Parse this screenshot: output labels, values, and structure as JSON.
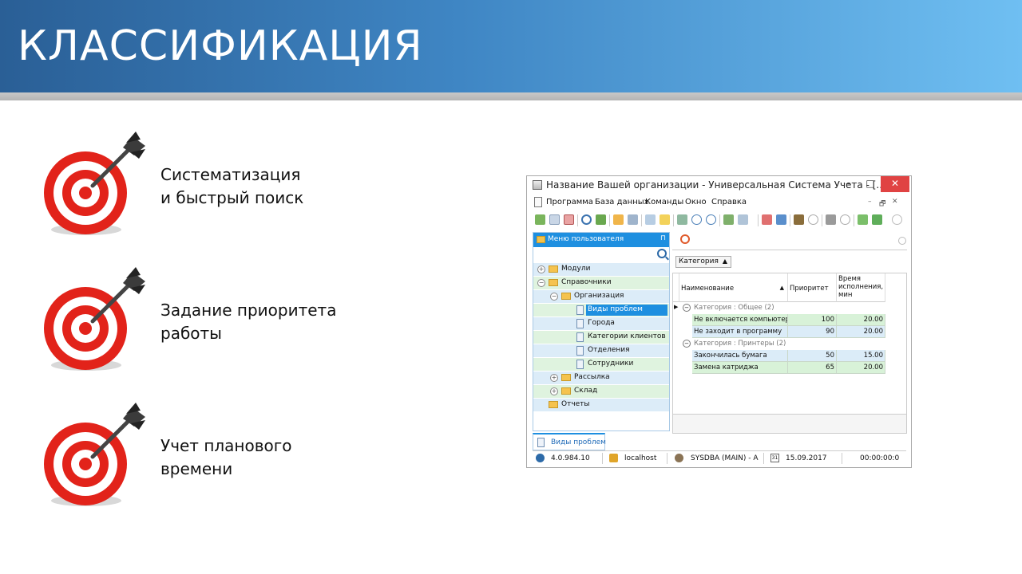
{
  "slide": {
    "title": "КЛАССИФИКАЦИЯ",
    "items": [
      {
        "line1": "Систематизация",
        "line2": "и быстрый поиск"
      },
      {
        "line1": "Задание приоритета",
        "line2": "работы"
      },
      {
        "line1": "Учет планового",
        "line2": "времени"
      }
    ],
    "icon": "target-dart-icon",
    "colors": {
      "banner_dark": "#2a5f96",
      "banner_light": "#6fbff2",
      "target_red": "#e2231a"
    }
  },
  "app": {
    "title": "Название Вашей организации - Универсальная Система Учета - [...",
    "window_buttons": {
      "minimize": "–",
      "maximize": "□",
      "close": "✕"
    },
    "menu": [
      "Программа",
      "База данных",
      "Команды",
      "Окно",
      "Справка"
    ],
    "mdi_buttons": [
      "–",
      "🗗",
      "✕"
    ],
    "left_panel": {
      "title": "Меню пользователя",
      "pin": "⊓",
      "tree": [
        {
          "label": "Модули",
          "level": 0,
          "expander": "+",
          "kind": "folder"
        },
        {
          "label": "Справочники",
          "level": 0,
          "expander": "−",
          "kind": "folder"
        },
        {
          "label": "Организация",
          "level": 1,
          "expander": "−",
          "kind": "folder"
        },
        {
          "label": "Виды проблем",
          "level": 2,
          "expander": "",
          "kind": "doc",
          "selected": true
        },
        {
          "label": "Города",
          "level": 2,
          "expander": "",
          "kind": "doc"
        },
        {
          "label": "Категории клиентов",
          "level": 2,
          "expander": "",
          "kind": "doc"
        },
        {
          "label": "Отделения",
          "level": 2,
          "expander": "",
          "kind": "doc"
        },
        {
          "label": "Сотрудники",
          "level": 2,
          "expander": "",
          "kind": "doc"
        },
        {
          "label": "Рассылка",
          "level": 1,
          "expander": "+",
          "kind": "folder"
        },
        {
          "label": "Склад",
          "level": 1,
          "expander": "+",
          "kind": "folder"
        },
        {
          "label": "Отчеты",
          "level": 0,
          "expander": "",
          "kind": "folder"
        }
      ]
    },
    "grid": {
      "group_by": "Категория",
      "group_sort_arrow": "▲",
      "columns": {
        "name": "Наименование",
        "name_sort": "▲",
        "priority": "Приоритет",
        "time_l1": "Время",
        "time_l2": "исполнения,",
        "time_l3": "мин"
      },
      "groups": [
        {
          "caption": "Категория : Общее (2)",
          "rows": [
            {
              "name": "Не включается компьютер",
              "priority": "100",
              "time": "20.00"
            },
            {
              "name": "Не заходит в программу",
              "priority": "90",
              "time": "20.00"
            }
          ]
        },
        {
          "caption": "Категория : Принтеры (2)",
          "rows": [
            {
              "name": "Закончилась бумага",
              "priority": "50",
              "time": "15.00"
            },
            {
              "name": "Замена катриджа",
              "priority": "65",
              "time": "20.00"
            }
          ]
        }
      ]
    },
    "doc_tab": "Виды проблем",
    "status": {
      "version": "4.0.984.10",
      "server": "localhost",
      "user": "SYSDBA (MAIN) - A",
      "calendar_day": "31",
      "date": "15.09.2017",
      "time": "00:00:00:0"
    }
  }
}
